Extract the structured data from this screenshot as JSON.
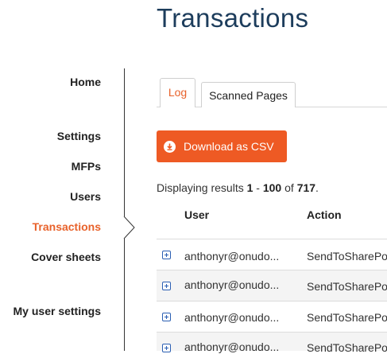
{
  "page": {
    "title": "Transactions"
  },
  "sidebar": {
    "items": [
      {
        "label": "Home",
        "active": false
      },
      {
        "label": "Settings",
        "active": false
      },
      {
        "label": "MFPs",
        "active": false
      },
      {
        "label": "Users",
        "active": false
      },
      {
        "label": "Transactions",
        "active": true
      },
      {
        "label": "Cover sheets",
        "active": false
      },
      {
        "label": "My user settings",
        "active": false
      }
    ]
  },
  "tabs": [
    {
      "label": "Log",
      "active": true
    },
    {
      "label": "Scanned Pages",
      "active": false
    }
  ],
  "toolbar": {
    "download_label": "Download as CSV",
    "download_icon": "download-circle-icon"
  },
  "results": {
    "prefix": "Displaying results ",
    "start": "1",
    "sep": " - ",
    "end": "100",
    "of": " of ",
    "total": "717",
    "suffix": "."
  },
  "table": {
    "columns": [
      "User",
      "Action"
    ],
    "rows": [
      {
        "user": "anthonyr@onudo...",
        "action": "SendToSharePo"
      },
      {
        "user": "anthonyr@onudo...",
        "action": "SendToSharePo"
      },
      {
        "user": "anthonyr@onudo...",
        "action": "SendToSharePo"
      },
      {
        "user": "anthonyr@onudo...",
        "action": "SendToSharePo"
      }
    ]
  },
  "colors": {
    "accent": "#ee5a24",
    "title": "#1d3d5c",
    "active_nav": "#e8622b"
  }
}
